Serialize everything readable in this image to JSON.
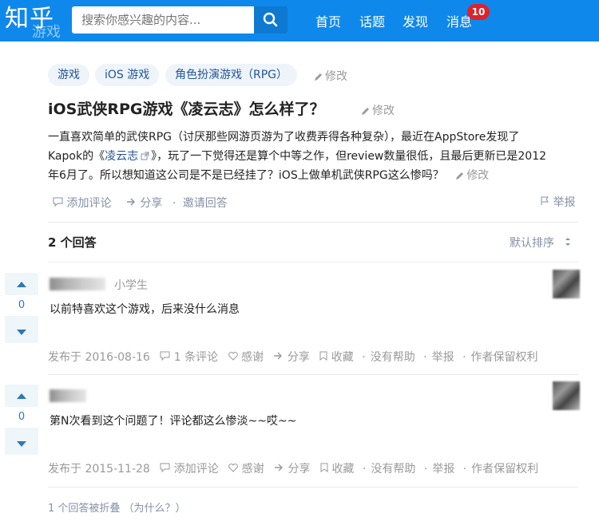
{
  "header": {
    "logo": "知乎",
    "watermark": "游戏",
    "search_placeholder": "搜索你感兴趣的内容...",
    "nav": [
      "首页",
      "话题",
      "发现",
      "消息"
    ],
    "message_badge": "10"
  },
  "question": {
    "tags": [
      "游戏",
      "iOS 游戏",
      "角色扮演游戏（RPG）"
    ],
    "edit_label": "修改",
    "title": "iOS武侠RPG游戏《凌云志》怎么样了？",
    "desc_line1": "一直喜欢简单的武侠RPG（讨厌那些网游页游为了收费弄得各种复杂），最近在AppStore发现了",
    "desc_line2_a": "Kapok的《",
    "desc_link": "凌云志",
    "desc_line2_b": "》，玩了一下觉得还是算个中等之作，但review数量很低，且最后更新已是2012",
    "desc_line3": "年6月了。所以想知道这公司是不是已经挂了？iOS上做单机武侠RPG这么惨吗？",
    "actions": [
      "添加评论",
      "分享",
      "邀请回答"
    ],
    "report": "举报"
  },
  "answers_header": {
    "count": "2 个回答",
    "sort": "默认排序"
  },
  "answers": [
    {
      "votes": "0",
      "role": "小学生",
      "text": "以前特喜欢这个游戏，后来没什么消息",
      "date": "发布于 2016-08-16",
      "comments": "1 条评论",
      "thanks": "感谢",
      "share": "分享",
      "collect": "收藏",
      "nohelp": "没有帮助",
      "report": "举报",
      "copyright": "作者保留权利"
    },
    {
      "votes": "0",
      "text": "第N次看到这个问题了！评论都这么惨淡~~哎~~",
      "date": "发布于 2015-11-28",
      "comments": "添加评论",
      "thanks": "感谢",
      "share": "分享",
      "collect": "收藏",
      "nohelp": "没有帮助",
      "report": "举报",
      "copyright": "作者保留权利"
    }
  ],
  "folded": "1 个回答被折叠 （为什么？）"
}
